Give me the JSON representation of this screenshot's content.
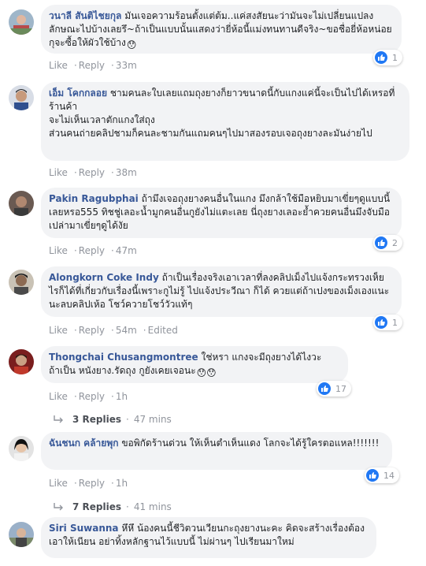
{
  "comments": [
    {
      "author": "วนาลี สันติไชยกุล",
      "text": "มันเจอความร้อนตั้งแต่ต้ม..แค่สงสัยนะว่ามันจะไม่เปลี่ยนแปลงลักษณะไปบ้างเลยรึ~ถ้าเป็นแบบนั้นแสดงว่ายี่ห้อนี้แม่งทนทานดีจริง~ขอชื่อยี่ห้อหน่อยกุจะซื้อให้ผัวใช้บ้าง",
      "emoji": "😯",
      "like": "Like",
      "reply": "Reply",
      "time": "33m",
      "reactions": "1"
    },
    {
      "author": "เอ็ม โคกกลอย",
      "text": "ชามคนละใบเลยแถมถุงยางก็ยาวขนาดนี้กับแกงแค่นี้จะเป็นไปได้เหรอที่ร้านค้า\nจะไม่เห็นเวลาตักแกงใส่ถุง\nส่วนคนถ่ายคลิปชามก็คนละชามกันแถมคนๆไปมาสองรอบเจอถุงยางละมันง่ายไป",
      "like": "Like",
      "reply": "Reply",
      "time": "38m"
    },
    {
      "author": "Pakin Ragubphai",
      "text": "ถ้ามึงเจอถุงยางคนอื่นในแกง มึงกล้าใช้มือหยิบมาเขี่ยๆดูแบบนี้เลยหรอ555 ทิชชู่เลอะน้ำมูกคนอื่นกูยังไม่แตะเลย นี่ถุงยางเลอะย้ำควยคนอื่นมึงจับมือเปล่ามาเขี่ยๆดูได้งัย",
      "like": "Like",
      "reply": "Reply",
      "time": "47m",
      "reactions": "2"
    },
    {
      "author": "Alongkorn Coke Indy",
      "text": "ถ้าเป็นเรื่องจริงเอาเวลาที่ลงคลิปเม็งไปแจ้งกระทรวงเห็ยไรก็ได้ที่เกี่ยวกับเรื่องนี้เพราะกูไม่รู้ ไปแจ้งประวีณา ก็ได้ ควยแต่ถ้าเปงของเม็งเองแนะนะลบคลิปเห้อ โชว์ควายโชว์วัวแท้ๆ",
      "like": "Like",
      "reply": "Reply",
      "time": "54m",
      "edited": "Edited",
      "reactions": "1"
    },
    {
      "author": "Thongchai Chusangmontree",
      "text": "ใช่หรา แกงจะมีถุงยางได้ไงวะ\nถ้าเป็น หนังยาง.รัดถุง กูยังเคยเจอนะ",
      "emoji": "😯😯",
      "like": "Like",
      "reply": "Reply",
      "time": "1h",
      "reactions": "17",
      "replies": {
        "count": "3 Replies",
        "time": "47 mins"
      }
    },
    {
      "author": "ฉันชนก คล้ายพุก",
      "text": "ขอพิกัดร้านด่วน ให้เห็นตำเห็นแดง โลกจะได้รู้ใครตอแหล!!!!!!!",
      "like": "Like",
      "reply": "Reply",
      "time": "1h",
      "reactions": "14",
      "replies": {
        "count": "7 Replies",
        "time": "41 mins"
      }
    },
    {
      "author": "Siri Suwanna",
      "text": "หึหึ น้องคนนี้ชีวิตวนเวียนกะถุงยางนะคะ คิดจะสร้างเรื่องต้องเอาให้เนียน อย่าทิ้งหลักฐานไว้แบบนี้ ไม่ผ่านๆ ไปเรียนมาใหม่"
    }
  ],
  "colors": {
    "author": "#385898",
    "bubble": "#f2f3f5",
    "meta": "#90949c",
    "like": "#2078f4"
  },
  "icons": {
    "like_badge": "thumbs-up-icon",
    "reply_arrow": "reply-arrow-icon"
  }
}
